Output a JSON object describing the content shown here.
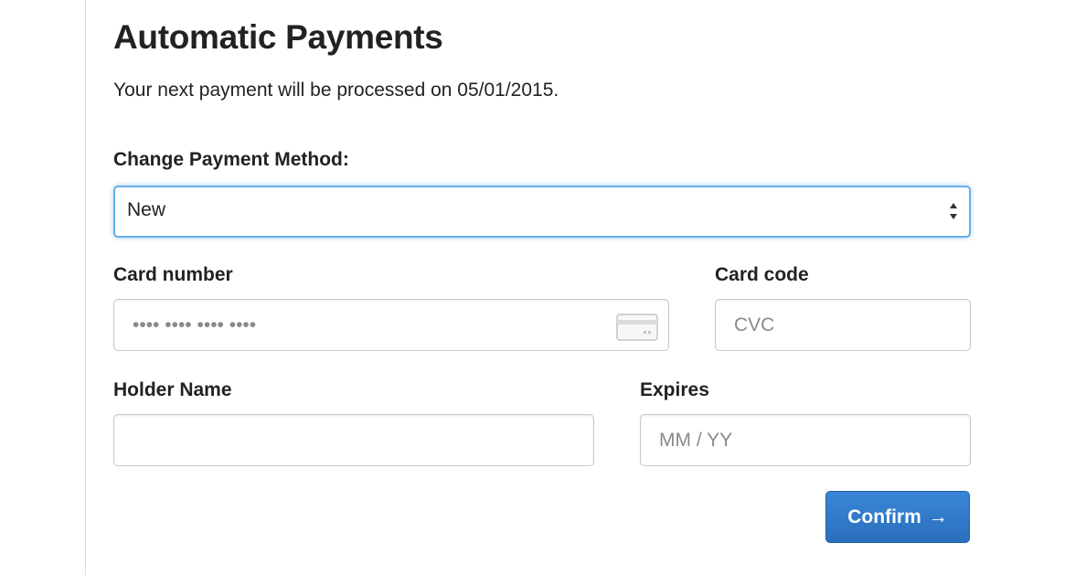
{
  "page": {
    "title": "Automatic Payments",
    "subtitle": "Your next payment will be processed on 05/01/2015."
  },
  "payment_method": {
    "label": "Change Payment Method:",
    "selected": "New"
  },
  "card_number": {
    "label": "Card number",
    "placeholder": "•••• •••• •••• ••••",
    "value": ""
  },
  "card_code": {
    "label": "Card code",
    "placeholder": "CVC",
    "value": ""
  },
  "holder_name": {
    "label": "Holder Name",
    "placeholder": "",
    "value": ""
  },
  "expires": {
    "label": "Expires",
    "placeholder": "MM / YY",
    "value": ""
  },
  "confirm": {
    "label": "Confirm",
    "arrow": "→"
  },
  "colors": {
    "button": "#2f7acb",
    "focus_border": "#66afe9"
  },
  "icons": {
    "select_arrows": "updown-arrows-icon",
    "card": "credit-card-icon",
    "confirm_arrow": "arrow-right-icon"
  }
}
